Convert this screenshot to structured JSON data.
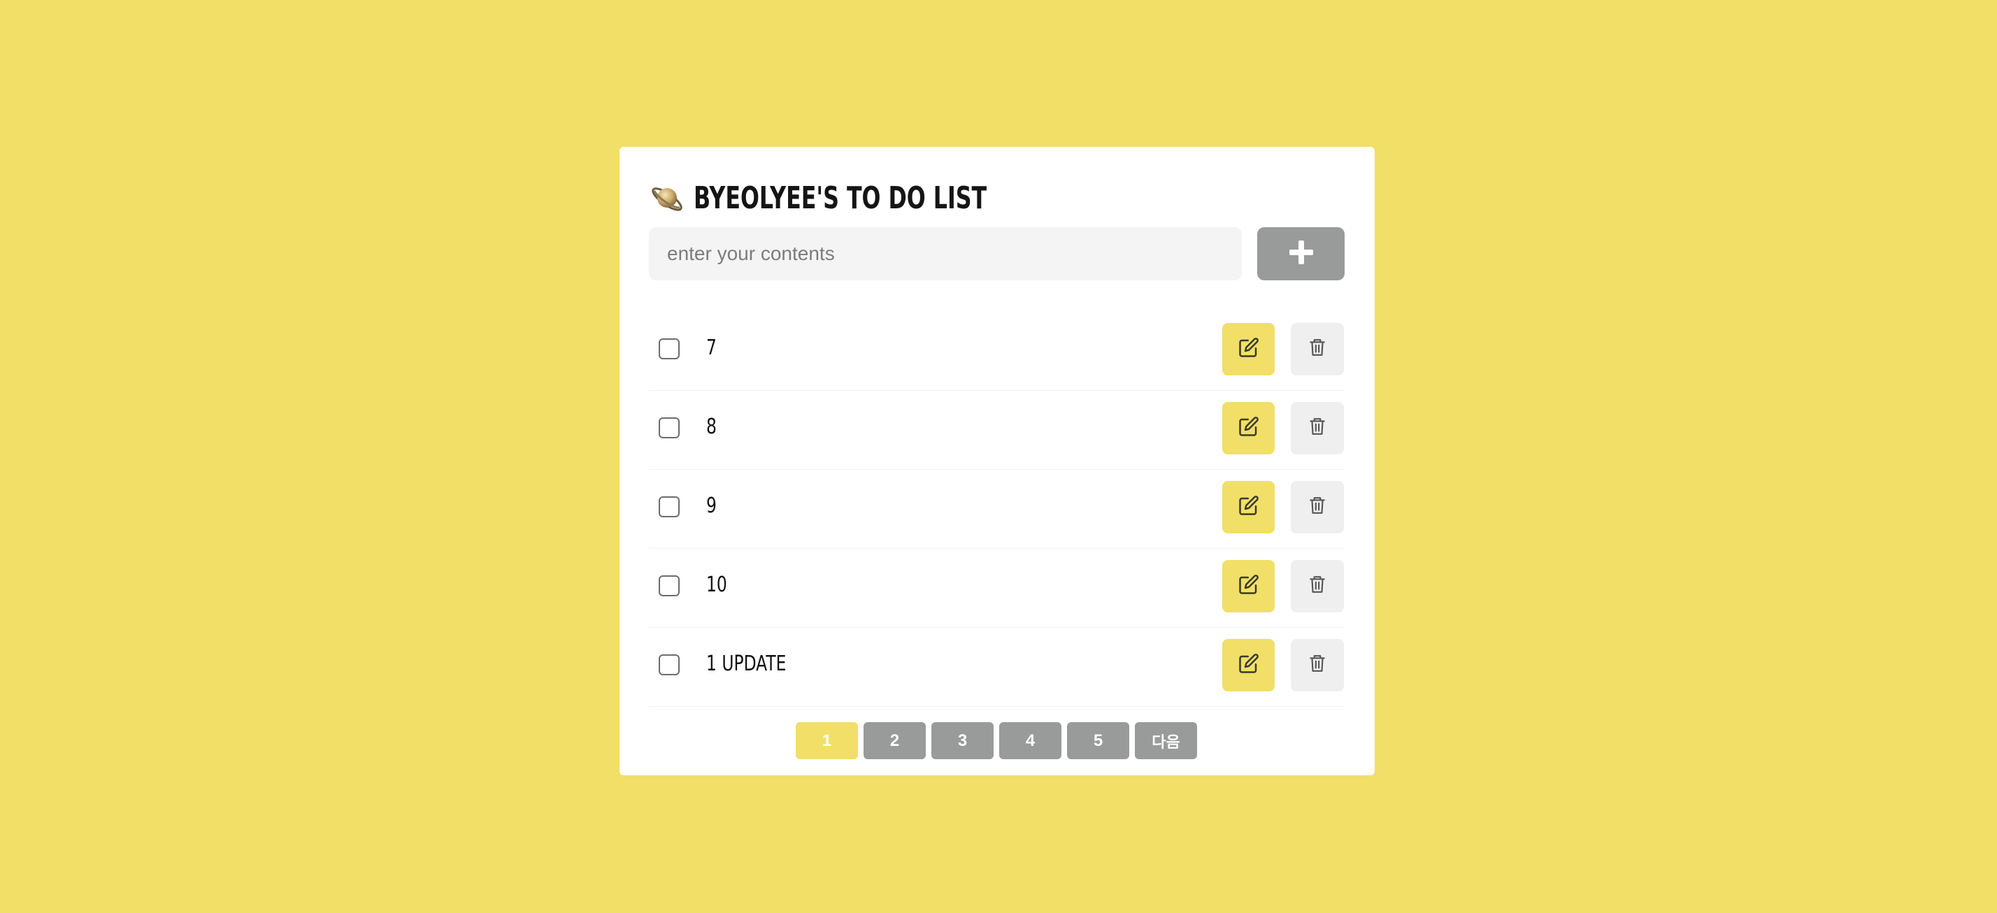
{
  "app": {
    "title": "BYEOLYEE'S TO DO LIST",
    "title_icon": "ringed-planet-icon"
  },
  "input": {
    "value": "",
    "placeholder": "enter your contents"
  },
  "add_button": {
    "icon": "plus-icon"
  },
  "todos": [
    {
      "text": "7",
      "checked": false
    },
    {
      "text": "8",
      "checked": false
    },
    {
      "text": "9",
      "checked": false
    },
    {
      "text": "10",
      "checked": false
    },
    {
      "text": "1 UPDATE",
      "checked": false
    }
  ],
  "row_actions": {
    "edit_icon": "pencil-square-icon",
    "delete_icon": "trash-icon"
  },
  "pagination": {
    "pages": [
      "1",
      "2",
      "3",
      "4",
      "5"
    ],
    "current": "1",
    "next_label": "다음"
  },
  "colors": {
    "background": "#f1df68",
    "card": "#ffffff",
    "accent": "#f1df68",
    "button_gray": "#999a9a",
    "delete_bg": "#efefef"
  }
}
